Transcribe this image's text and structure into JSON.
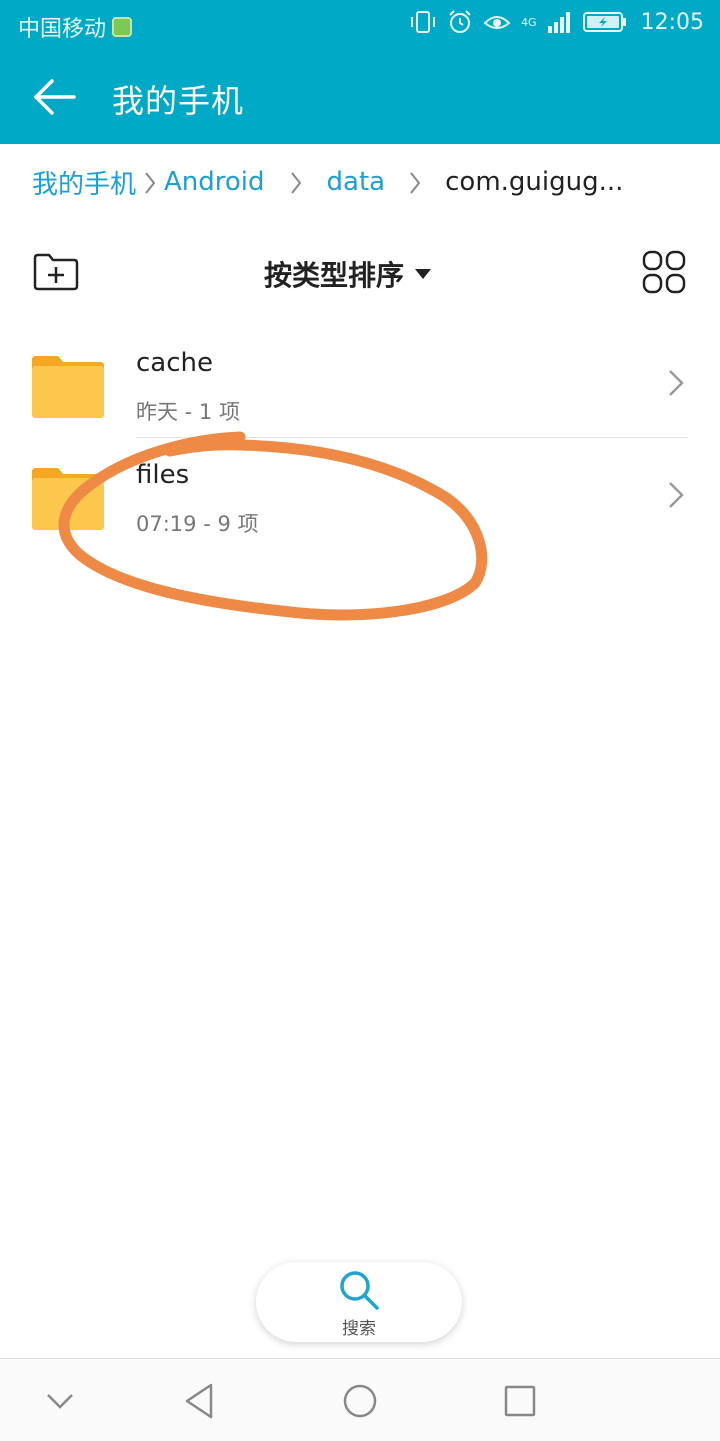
{
  "status_bar": {
    "carrier": "中国移动",
    "time": "12:05",
    "network": "4G"
  },
  "app_bar": {
    "title": "我的手机"
  },
  "breadcrumb": {
    "items": [
      "我的手机",
      "Android",
      "data",
      "com.guigug..."
    ]
  },
  "toolbar": {
    "sort_label": "按类型排序"
  },
  "files": [
    {
      "name": "cache",
      "meta": "昨天 - 1 项"
    },
    {
      "name": "files",
      "meta": "07:19 - 9 项"
    }
  ],
  "search": {
    "label": "搜索"
  },
  "colors": {
    "accent": "#00a9c6",
    "link": "#1a9fd8",
    "folder": "#fcc74c",
    "annotation": "#ee8a45"
  }
}
